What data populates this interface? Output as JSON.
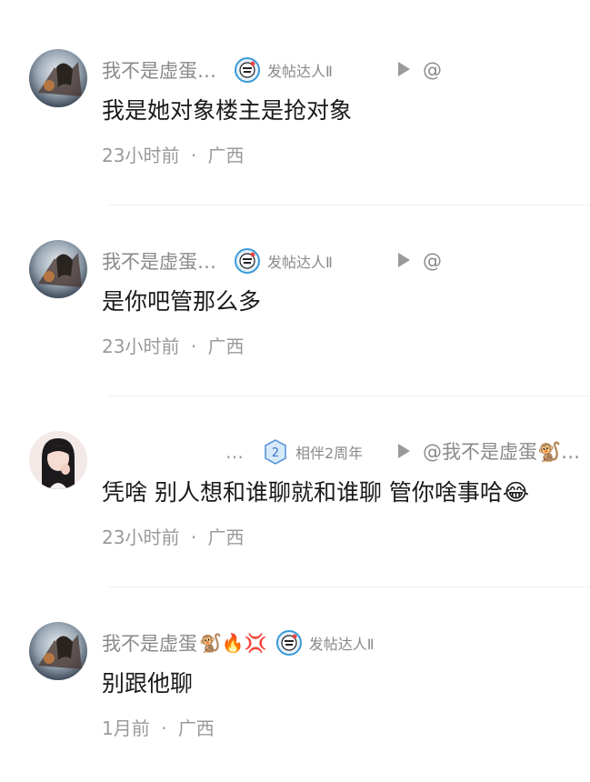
{
  "comments": [
    {
      "username": "我不是虚蛋…",
      "badge": "发帖达人Ⅱ",
      "reply_target": "@",
      "content": "我是她对象楼主是抢对象",
      "time": "23小时前",
      "dot": "·",
      "location": "广西"
    },
    {
      "username": "我不是虚蛋…",
      "badge": "发帖达人Ⅱ",
      "reply_target": "@",
      "content": "是你吧管那么多",
      "time": "23小时前",
      "dot": "·",
      "location": "广西"
    },
    {
      "username": "…",
      "badge": "相伴2周年",
      "badge_number": "2",
      "reply_target": "@我不是虚蛋🐒…",
      "content": "凭啥 别人想和谁聊就和谁聊  管你啥事哈😂",
      "time": "23小时前",
      "dot": "·",
      "location": "广西"
    },
    {
      "username": "我不是虚蛋",
      "username_emojis": "🐒🔥💢",
      "badge": "发帖达人Ⅱ",
      "content": "别跟他聊",
      "time": "1月前",
      "dot": "·",
      "location": "广西"
    }
  ],
  "colors": {
    "text": "#1a1a1a",
    "secondary": "#8a8a8a",
    "divider": "#f0f0f0"
  }
}
